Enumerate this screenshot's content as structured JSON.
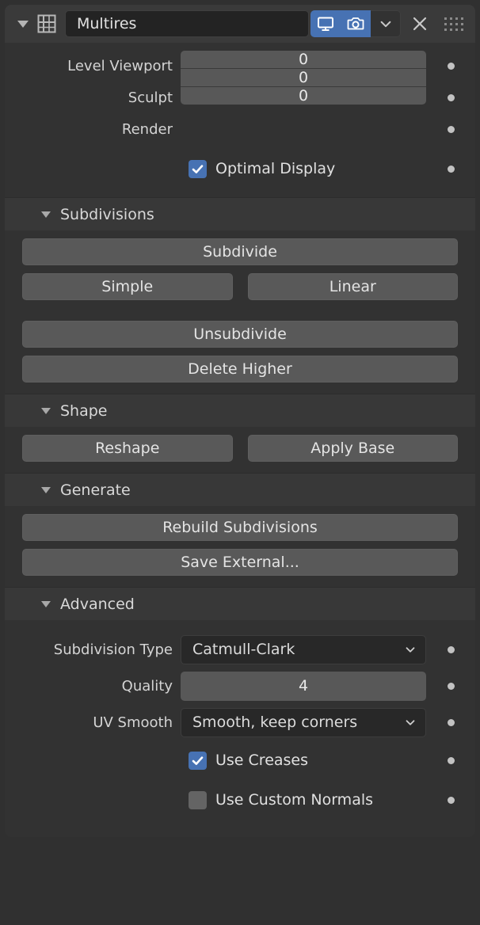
{
  "header": {
    "modifier_name": "Multires",
    "type_icon": "multires-grid-icon",
    "expand_icon": "triangle-down-icon",
    "toggles": [
      {
        "name": "display-in-viewport-icon",
        "active": true
      },
      {
        "name": "render-icon",
        "active": true
      }
    ],
    "extras_icon": "chevron-down-icon",
    "close_icon": "close-x-icon",
    "drag_icon": "drag-grip-icon"
  },
  "levels": {
    "rows": [
      {
        "label": "Level Viewport",
        "value": "0"
      },
      {
        "label": "Sculpt",
        "value": "0"
      },
      {
        "label": "Render",
        "value": "0"
      }
    ],
    "optimal_display": {
      "label": "Optimal Display",
      "checked": true
    }
  },
  "sections": [
    {
      "title": "Subdivisions",
      "buttons_full": [
        "Subdivide"
      ],
      "buttons_pair": [
        "Simple",
        "Linear"
      ],
      "buttons_full2": [
        "Unsubdivide",
        "Delete Higher"
      ]
    },
    {
      "title": "Shape",
      "buttons_pair": [
        "Reshape",
        "Apply Base"
      ]
    },
    {
      "title": "Generate",
      "buttons_full": [
        "Rebuild Subdivisions",
        "Save External..."
      ]
    },
    {
      "title": "Advanced"
    }
  ],
  "advanced": {
    "subdivision_type": {
      "label": "Subdivision Type",
      "value": "Catmull-Clark"
    },
    "quality": {
      "label": "Quality",
      "value": "4"
    },
    "uv_smooth": {
      "label": "UV Smooth",
      "value": "Smooth, keep corners"
    },
    "use_creases": {
      "label": "Use Creases",
      "checked": true
    },
    "use_custom_normals": {
      "label": "Use Custom Normals",
      "checked": false
    }
  },
  "colors": {
    "accent_blue": "#4772b3",
    "panel_bg": "#323232",
    "section_header_bg": "#383838",
    "field_bg": "#585858",
    "dropdown_bg": "#282828",
    "outer_bg": "#303030"
  }
}
